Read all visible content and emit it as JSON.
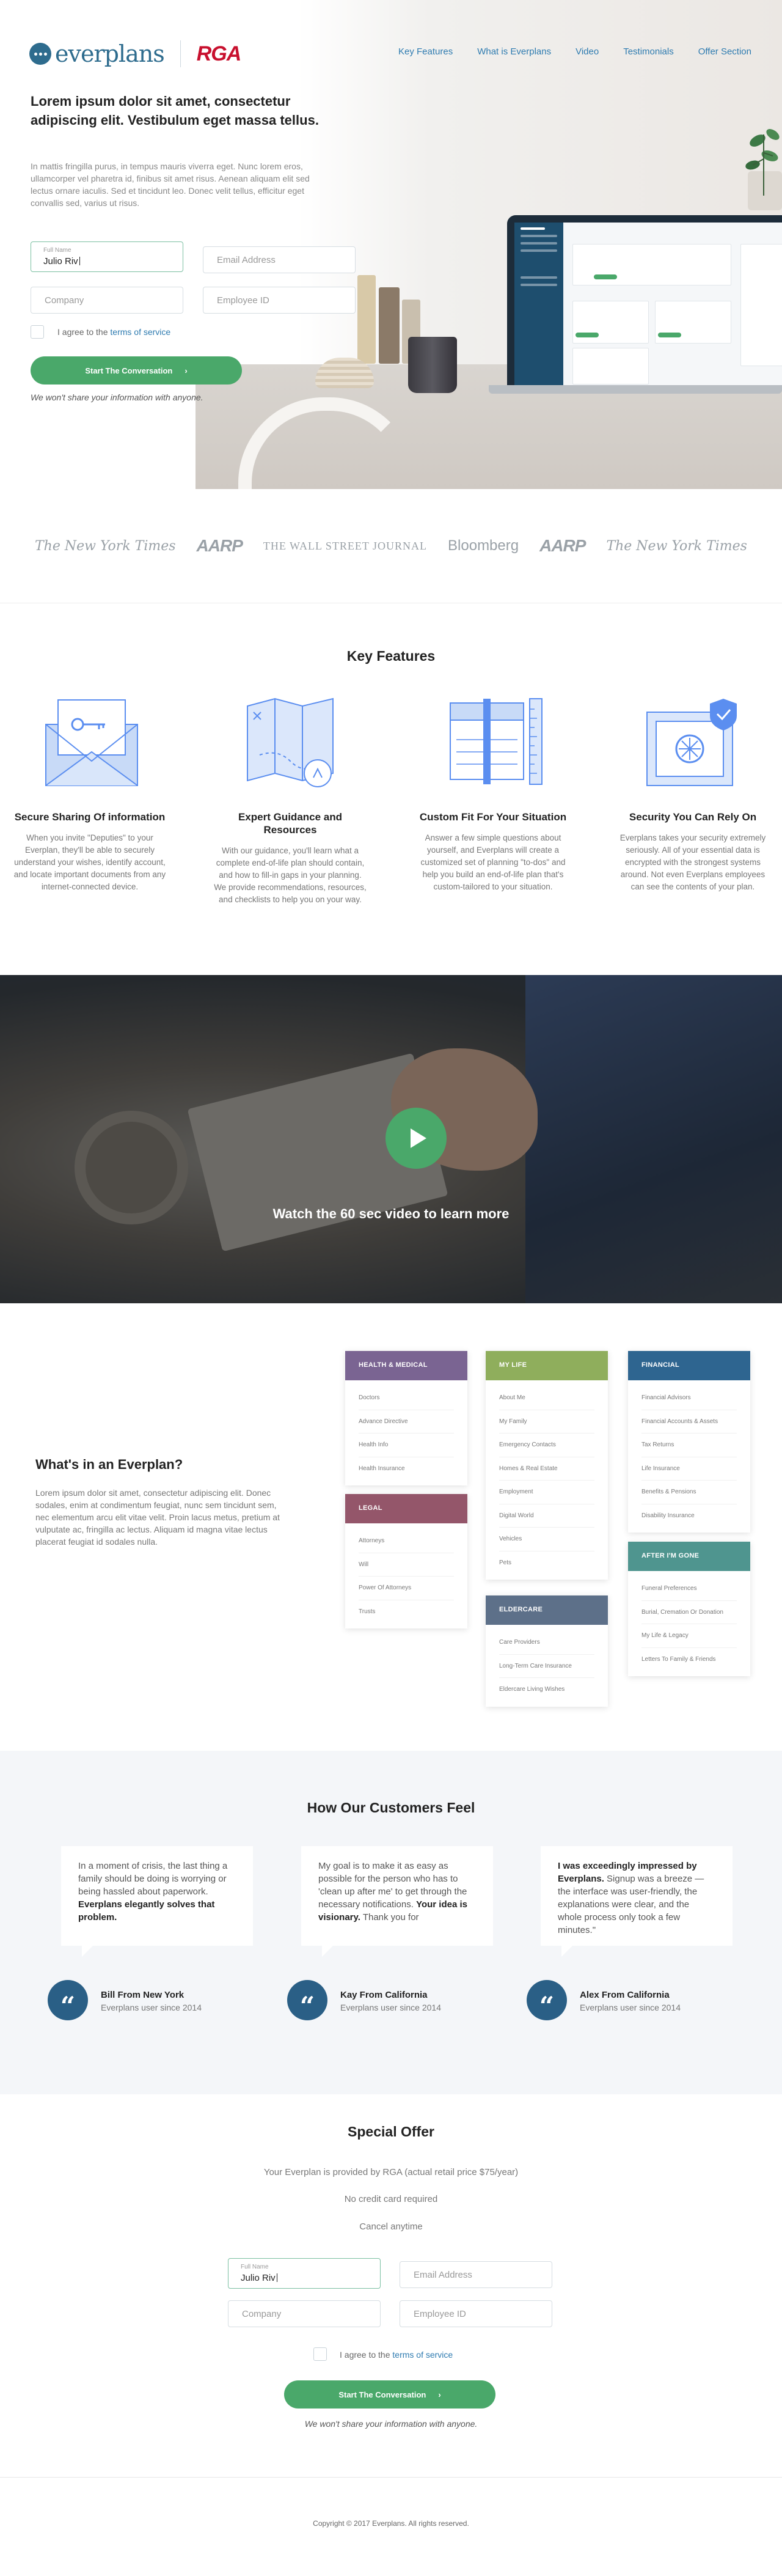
{
  "header": {
    "brand": "everplans",
    "partner": "RGA",
    "nav": [
      "Key Features",
      "What is Everplans",
      "Video",
      "Testimonials",
      "Offer Section"
    ]
  },
  "hero": {
    "title": "Lorem ipsum dolor sit amet, consectetur adipiscing elit. Vestibulum eget massa tellus.",
    "description": "In mattis fringilla purus, in tempus mauris viverra eget. Nunc lorem eros, ullamcorper vel pharetra id, finibus sit amet risus. Aenean aliquam elit sed lectus ornare iaculis. Sed et tincidunt leo. Donec velit tellus, efficitur eget convallis sed, varius ut risus.",
    "form": {
      "full_name_label": "Full Name",
      "full_name_value": "Julio Riv",
      "email_placeholder": "Email Address",
      "company_placeholder": "Company",
      "employee_placeholder": "Employee ID",
      "agree_text": "I agree to the",
      "terms_link": "terms of service",
      "cta": "Start The Conversation",
      "privacy": "We won't share your information with anyone."
    }
  },
  "press_logos": [
    "The New York Times",
    "AARP",
    "THE WALL STREET JOURNAL",
    "Bloomberg",
    "AARP",
    "The New York Times"
  ],
  "features": {
    "title": "Key Features",
    "items": [
      {
        "title": "Secure Sharing Of information",
        "text": "When you invite \"Deputies\" to your Everplan, they'll be able to securely understand your wishes, identify account, and locate important documents from any internet-connected device."
      },
      {
        "title": "Expert Guidance and Resources",
        "text": "With our guidance, you'll learn what a complete end-of-life plan should contain, and how to fill-in gaps in your planning. We provide recommendations, resources, and checklists to help you on your way."
      },
      {
        "title": "Custom Fit For Your Situation",
        "text": "Answer a few simple questions about yourself, and Everplans will create a customized set of planning \"to-dos\" and help you build an end-of-life plan that's custom-tailored to your situation."
      },
      {
        "title": "Security You Can Rely On",
        "text": "Everplans takes your security extremely seriously. All of your essential data is encrypted with the strongest systems around. Not even Everplans employees can see the contents of your plan."
      }
    ]
  },
  "video": {
    "caption": "Watch the 60 sec video to learn more"
  },
  "whats_in": {
    "title": "What's in an Everplan?",
    "text": "Lorem ipsum dolor sit amet, consectetur adipiscing elit. Donec sodales, enim at condimentum feugiat, nunc sem tincidunt sem, nec elementum arcu elit vitae velit. Proin lacus metus, pretium at vulputate ac, fringilla ac lectus. Aliquam id magna vitae lectus placerat feugiat id sodales nulla.",
    "categories": [
      {
        "name": "HEALTH & MEDICAL",
        "color": "#7a6492",
        "items": [
          "Doctors",
          "Advance Directive",
          "Health Info",
          "Health Insurance"
        ]
      },
      {
        "name": "LEGAL",
        "color": "#94566a",
        "items": [
          "Attorneys",
          "Will",
          "Power Of Attorneys",
          "Trusts"
        ]
      },
      {
        "name": "MY LIFE",
        "color": "#8fae5c",
        "items": [
          "About Me",
          "My Family",
          "Emergency Contacts",
          "Homes & Real Estate",
          "Employment",
          "Digital World",
          "Vehicles",
          "Pets"
        ]
      },
      {
        "name": "ELDERCARE",
        "color": "#5d7089",
        "items": [
          "Care Providers",
          "Long-Term Care Insurance",
          "Eldercare Living Wishes"
        ]
      },
      {
        "name": "FINANCIAL",
        "color": "#2e6590",
        "items": [
          "Financial Advisors",
          "Financial Accounts & Assets",
          "Tax Returns",
          "Life Insurance",
          "Benefits & Pensions",
          "Disability Insurance"
        ]
      },
      {
        "name": "AFTER I'M GONE",
        "color": "#4f958f",
        "items": [
          "Funeral Preferences",
          "Burial, Cremation Or Donation",
          "My Life & Legacy",
          "Letters To Family & Friends"
        ]
      }
    ]
  },
  "testimonials": {
    "title": "How Our Customers Feel",
    "items": [
      {
        "text_a": "In a moment of crisis, the last thing a family should be doing is worrying or being hassled about paperwork. ",
        "text_b": "Everplans elegantly solves that problem.",
        "text_c": "",
        "name": "Bill From New York",
        "since": "Everplans user since 2014"
      },
      {
        "text_a": "My goal is to make it as easy as possible for the person who has to 'clean up after me' to get through the necessary notifications. ",
        "text_b": "Your idea is visionary.",
        "text_c": " Thank you for",
        "name": "Kay From California",
        "since": "Everplans user since 2014"
      },
      {
        "text_a": "",
        "text_b": "I was exceedingly impressed by Everplans.",
        "text_c": " Signup was a breeze — the interface was user-friendly, the explanations were clear, and the whole process only took a few minutes.\"",
        "name": "Alex From California",
        "since": "Everplans user since 2014"
      }
    ]
  },
  "offer": {
    "title": "Special Offer",
    "lines": [
      "Your Everplan is provided by RGA (actual retail price $75/year)",
      "No credit card required",
      "Cancel anytime"
    ],
    "form": {
      "full_name_label": "Full Name",
      "full_name_value": "Julio Riv",
      "email_placeholder": "Email Address",
      "company_placeholder": "Company",
      "employee_placeholder": "Employee ID",
      "agree_text": "I agree to the",
      "terms_link": "terms of service",
      "cta": "Start The Conversation",
      "privacy": "We won't share your information with anyone."
    }
  },
  "footer": {
    "copyright": "Copyright © 2017 Everplans. All rights reserved."
  }
}
